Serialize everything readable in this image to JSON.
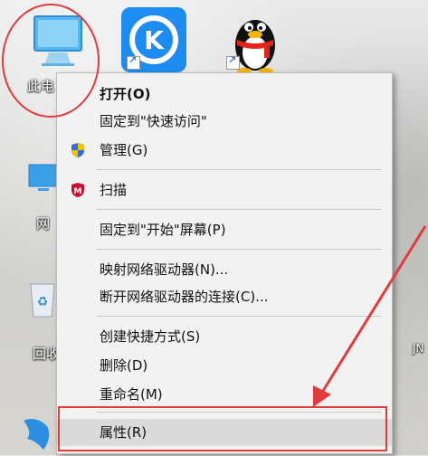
{
  "desktop": {
    "this_pc_label": "此电",
    "network_label": "网",
    "recycle_label": "回收",
    "right_edge_label": "JN"
  },
  "context_menu": {
    "items": [
      {
        "label": "打开(O)"
      },
      {
        "label": "固定到\"快速访问\""
      },
      {
        "label": "管理(G)"
      },
      {
        "label": "扫描"
      },
      {
        "label": "固定到\"开始\"屏幕(P)"
      },
      {
        "label": "映射网络驱动器(N)..."
      },
      {
        "label": "断开网络驱动器的连接(C)..."
      },
      {
        "label": "创建快捷方式(S)"
      },
      {
        "label": "删除(D)"
      },
      {
        "label": "重命名(M)"
      },
      {
        "label": "属性(R)"
      }
    ]
  },
  "colors": {
    "annotation_red": "#e23b3b",
    "menu_bg": "#f2f2f2"
  }
}
